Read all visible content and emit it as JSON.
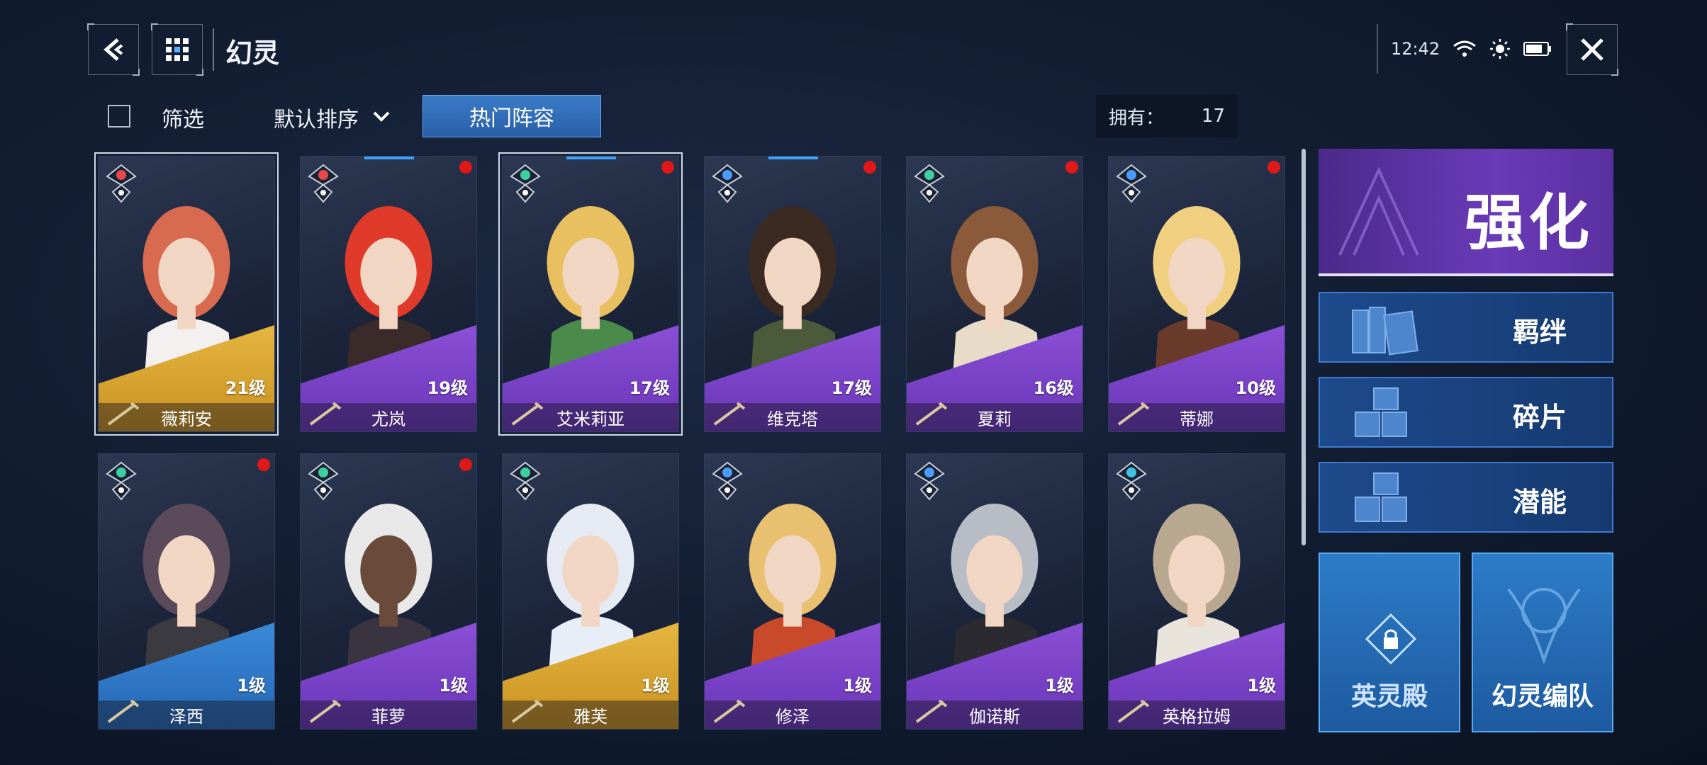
{
  "header": {
    "title": "幻灵",
    "time": "12:42"
  },
  "filters": {
    "filter_label": "筛选",
    "sort_label": "默认排序",
    "hot_lineup_label": "热门阵容",
    "owned_label": "拥有：",
    "owned_count": "17"
  },
  "cards": [
    {
      "name": "薇莉安",
      "level": "21级",
      "rarity": "gold",
      "element": "fire",
      "red_dot": false
    },
    {
      "name": "尤岚",
      "level": "19级",
      "rarity": "purple",
      "element": "fire",
      "red_dot": true
    },
    {
      "name": "艾米莉亚",
      "level": "17级",
      "rarity": "purple",
      "element": "wind",
      "red_dot": true
    },
    {
      "name": "维克塔",
      "level": "17级",
      "rarity": "purple",
      "element": "thunder",
      "red_dot": true
    },
    {
      "name": "夏莉",
      "level": "16级",
      "rarity": "purple",
      "element": "wind",
      "red_dot": true
    },
    {
      "name": "蒂娜",
      "level": "10级",
      "rarity": "purple",
      "element": "thunder",
      "red_dot": true
    },
    {
      "name": "泽西",
      "level": "1级",
      "rarity": "blue",
      "element": "wind",
      "red_dot": true
    },
    {
      "name": "菲萝",
      "level": "1级",
      "rarity": "purple",
      "element": "wind",
      "red_dot": true
    },
    {
      "name": "雅芙",
      "level": "1级",
      "rarity": "gold",
      "element": "wind",
      "red_dot": false
    },
    {
      "name": "修泽",
      "level": "1级",
      "rarity": "purple",
      "element": "thunder",
      "red_dot": false
    },
    {
      "name": "伽诺斯",
      "level": "1级",
      "rarity": "purple",
      "element": "thunder",
      "red_dot": false
    },
    {
      "name": "英格拉姆",
      "level": "1级",
      "rarity": "purple",
      "element": "water",
      "red_dot": false
    }
  ],
  "side": {
    "enhance": "强化",
    "bond": "羁绊",
    "fragment": "碎片",
    "potential": "潜能",
    "hall": "英灵殿",
    "team": "幻灵编队"
  },
  "colors": {
    "gold": "#e6b640",
    "purple": "#8a4fd6",
    "blue": "#3a8ad8",
    "accent": "#3a7cc8",
    "red_dot": "#e01818"
  }
}
